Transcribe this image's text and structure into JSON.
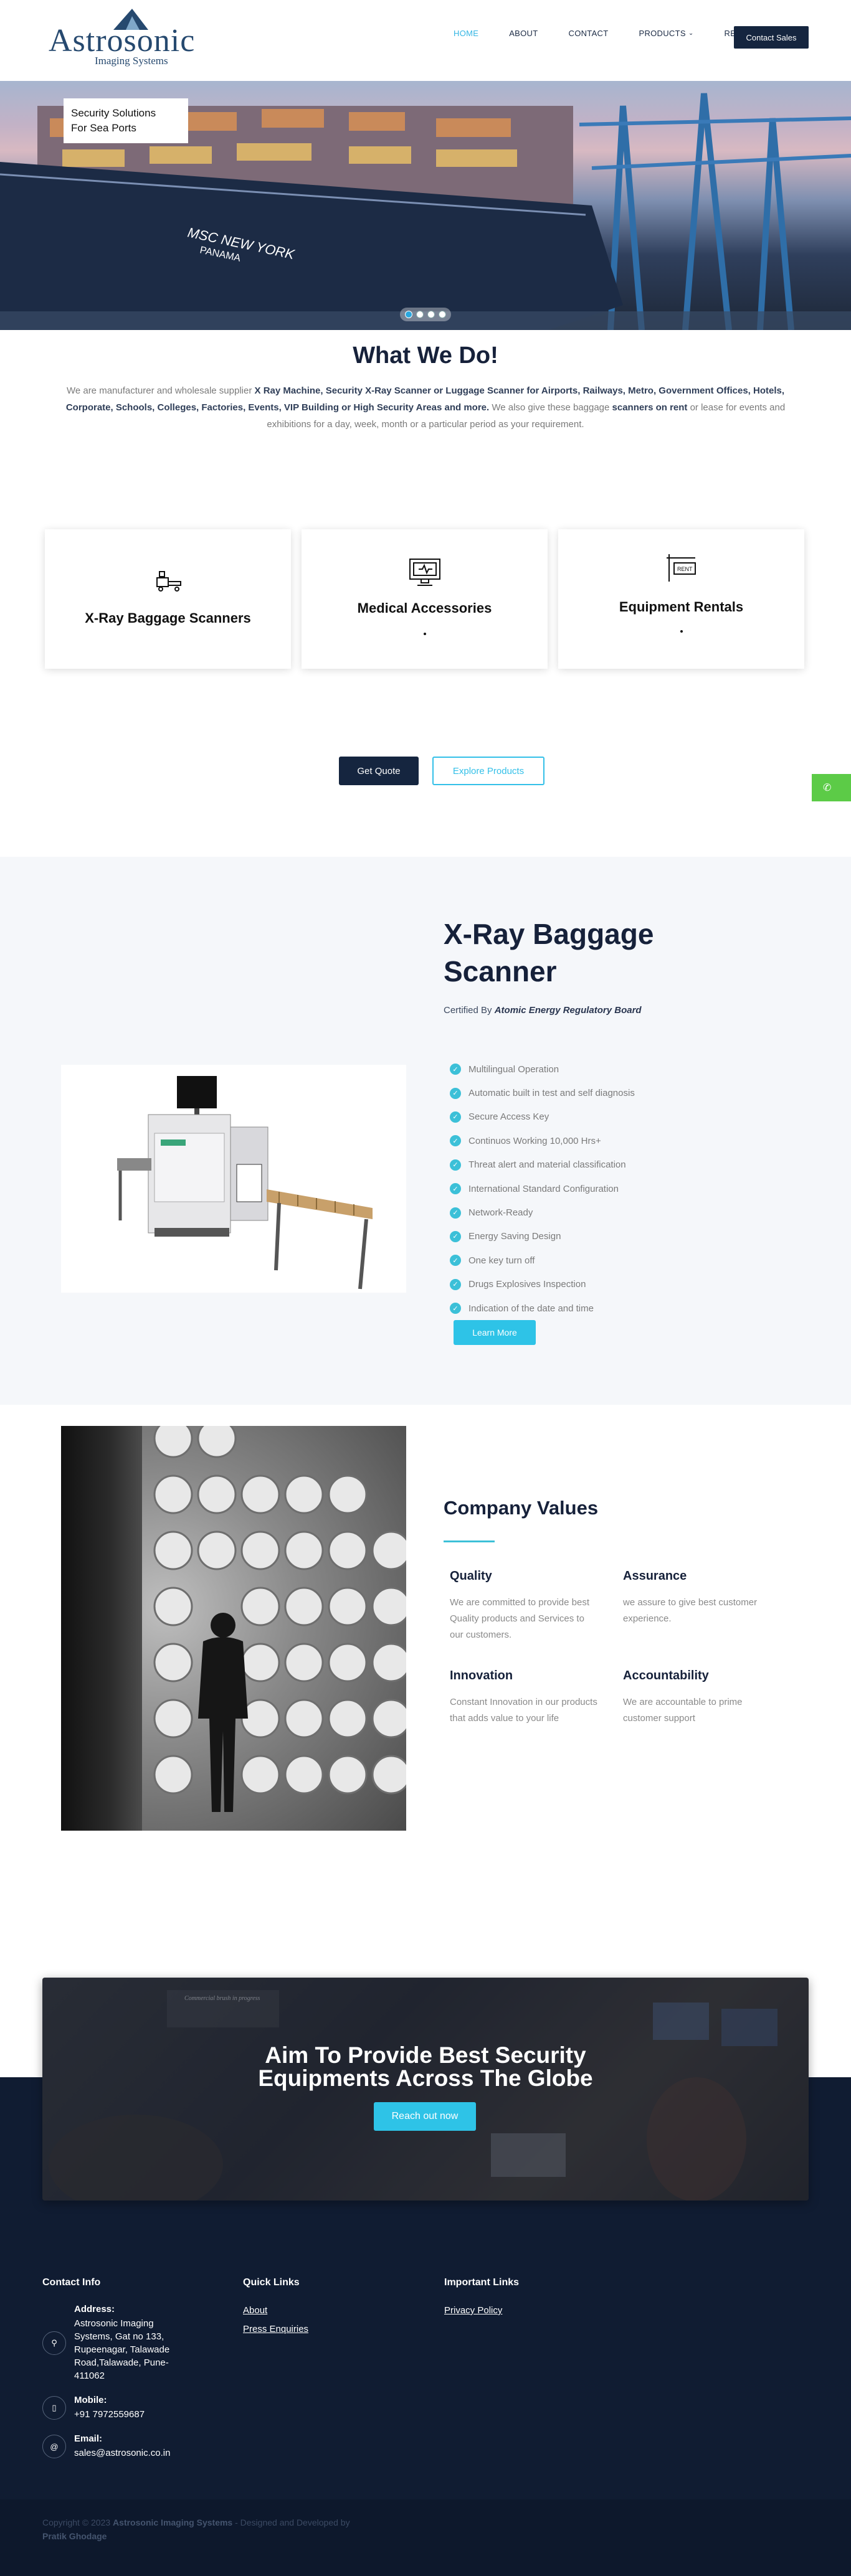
{
  "brand": {
    "name": "Astrosonic",
    "tagline": "Imaging Systems",
    "color_primary": "#15253f",
    "color_accent": "#2ec3e7"
  },
  "nav": {
    "items": [
      "HOME",
      "ABOUT",
      "CONTACT",
      "PRODUCTS",
      "RENTALS"
    ],
    "active": "HOME",
    "cta": "Contact Sales"
  },
  "hero": {
    "caption_line1": "Security Solutions",
    "caption_line2": "For Sea Ports",
    "ship_text1": "MSC NEW YORK",
    "ship_text2": "PANAMA",
    "slides": 4,
    "active_slide": 1
  },
  "what_we_do": {
    "title": "What We Do!",
    "text_1": "We are manufacturer and wholesale supplier ",
    "text_2": "X Ray Machine, Security X-Ray Scanner or Luggage Scanner for Airports, Railways, Metro, Government Offices, Hotels, Corporate, Schools, Colleges, Factories, Events, VIP Building or High Security Areas and more.",
    "text_3": "  We also give these baggage ",
    "text_4": "scanners on rent",
    "text_5": " or lease for events and exhibitions for a day, week, month or a particular period as your requirement."
  },
  "cards": [
    {
      "label": "X-Ray Baggage Scanners",
      "icon": "scanner-icon"
    },
    {
      "label": "Medical Accessories",
      "icon": "monitor-icon"
    },
    {
      "label": "Equipment Rentals",
      "icon": "rent-sign-icon"
    }
  ],
  "actions": {
    "quote": "Get Quote",
    "explore": "Explore Products"
  },
  "whatsapp": {
    "icon": "whatsapp-icon"
  },
  "xray": {
    "title": "X-Ray Baggage Scanner",
    "certified_prefix": "Certified By ",
    "certified_by": "Atomic Energy Regulatory Board",
    "features": [
      "Multilingual Operation",
      "Automatic built in test and self diagnosis",
      "Secure Access Key",
      "Continuos Working 10,000 Hrs+",
      "Threat alert and material classification",
      "International Standard Configuration",
      "Network-Ready",
      "Energy Saving Design",
      "One key turn off",
      "Drugs Explosives Inspection",
      "Indication of the date and time"
    ],
    "learn_more": "Learn More"
  },
  "values": {
    "title": "Company Values",
    "items": [
      {
        "title": "Quality",
        "text": "We are committed to provide best Quality products and Services to our customers."
      },
      {
        "title": "Assurance",
        "text": "we assure to give best customer experience."
      },
      {
        "title": "Innovation",
        "text": "Constant Innovation in our products that  adds value to your life"
      },
      {
        "title": "Accountability",
        "text": "We are accountable to prime customer support"
      }
    ]
  },
  "cta": {
    "title_line1": "Aim To Provide Best Security",
    "title_line2": "Equipments Across The Globe",
    "button": "Reach out now",
    "board_text": "Commercial brush in progress"
  },
  "footer": {
    "contact_head": "Contact Info",
    "quick_head": "Quick Links",
    "important_head": "Important Links",
    "address_label": "Address:",
    "address": "Astrosonic Imaging Systems, Gat no 133, Rupeenagar, Talawade Road,Talawade, Pune-411062",
    "mobile_label": "Mobile:",
    "mobile": "+91 7972559687",
    "email_label": "Email:",
    "email": "sales@astrosonic.co.in",
    "quick_links": [
      "About",
      "Press Enquiries"
    ],
    "important_links": [
      "Privacy Policy"
    ],
    "copyright_prefix": "Copyright © 2023 ",
    "copyright_company": "Astrosonic Imaging Systems",
    "copyright_mid": " - Designed and Developed by ",
    "copyright_dev": "Pratik Ghodage"
  }
}
